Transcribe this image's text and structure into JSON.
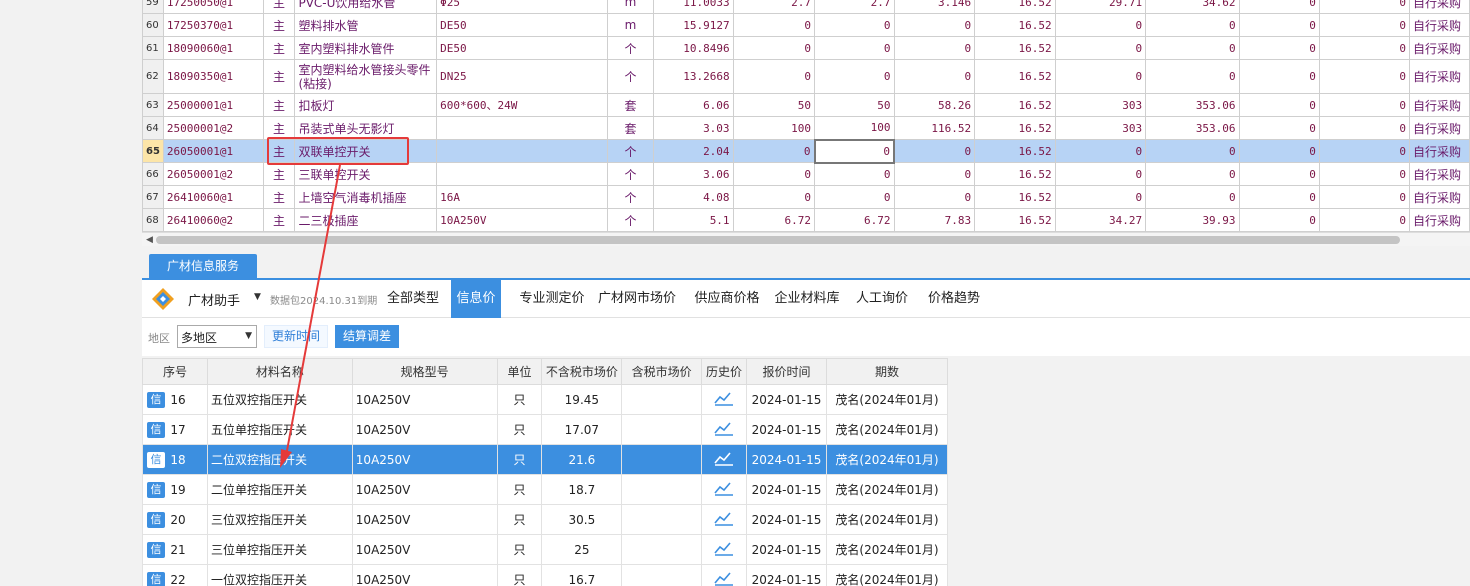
{
  "top_grid": {
    "rows": [
      {
        "num": "59",
        "code": "17250050@1",
        "type": "主",
        "name": "PVC-U饮用给水管",
        "spec": "Φ25",
        "unit": "m",
        "qty": "11.0033",
        "p1": "2.7",
        "p2": "2.7",
        "p3": "3.146",
        "tax": "16.52",
        "a1": "29.71",
        "a2": "34.62",
        "z1": "0",
        "z2": "0",
        "src": "自行采购"
      },
      {
        "num": "60",
        "code": "17250370@1",
        "type": "主",
        "name": "塑料排水管",
        "spec": "DE50",
        "unit": "m",
        "qty": "15.9127",
        "p1": "0",
        "p2": "0",
        "p3": "0",
        "tax": "16.52",
        "a1": "0",
        "a2": "0",
        "z1": "0",
        "z2": "0",
        "src": "自行采购"
      },
      {
        "num": "61",
        "code": "18090060@1",
        "type": "主",
        "name": "室内塑料排水管件",
        "spec": "DE50",
        "unit": "个",
        "qty": "10.8496",
        "p1": "0",
        "p2": "0",
        "p3": "0",
        "tax": "16.52",
        "a1": "0",
        "a2": "0",
        "z1": "0",
        "z2": "0",
        "src": "自行采购"
      },
      {
        "num": "62",
        "code": "18090350@1",
        "type": "主",
        "name": "室内塑料给水管接头零件(粘接)",
        "spec": "DN25",
        "unit": "个",
        "qty": "13.2668",
        "p1": "0",
        "p2": "0",
        "p3": "0",
        "tax": "16.52",
        "a1": "0",
        "a2": "0",
        "z1": "0",
        "z2": "0",
        "src": "自行采购"
      },
      {
        "num": "63",
        "code": "25000001@1",
        "type": "主",
        "name": "扣板灯",
        "spec": "600*600、24W",
        "unit": "套",
        "qty": "6.06",
        "p1": "50",
        "p2": "50",
        "p3": "58.26",
        "tax": "16.52",
        "a1": "303",
        "a2": "353.06",
        "z1": "0",
        "z2": "0",
        "src": "自行采购"
      },
      {
        "num": "64",
        "code": "25000001@2",
        "type": "主",
        "name": "吊装式单头无影灯",
        "spec": "",
        "unit": "套",
        "qty": "3.03",
        "p1": "100",
        "p2": "100",
        "p3": "116.52",
        "tax": "16.52",
        "a1": "303",
        "a2": "353.06",
        "z1": "0",
        "z2": "0",
        "src": "自行采购"
      },
      {
        "num": "65",
        "code": "26050001@1",
        "type": "主",
        "name": "双联单控开关",
        "spec": "",
        "unit": "个",
        "qty": "2.04",
        "p1": "0",
        "p2": "0",
        "p3": "0",
        "tax": "16.52",
        "a1": "0",
        "a2": "0",
        "z1": "0",
        "z2": "0",
        "src": "自行采购"
      },
      {
        "num": "66",
        "code": "26050001@2",
        "type": "主",
        "name": "三联单控开关",
        "spec": "",
        "unit": "个",
        "qty": "3.06",
        "p1": "0",
        "p2": "0",
        "p3": "0",
        "tax": "16.52",
        "a1": "0",
        "a2": "0",
        "z1": "0",
        "z2": "0",
        "src": "自行采购"
      },
      {
        "num": "67",
        "code": "26410060@1",
        "type": "主",
        "name": "上墙空气消毒机插座",
        "spec": "16A",
        "unit": "个",
        "qty": "4.08",
        "p1": "0",
        "p2": "0",
        "p3": "0",
        "tax": "16.52",
        "a1": "0",
        "a2": "0",
        "z1": "0",
        "z2": "0",
        "src": "自行采购"
      },
      {
        "num": "68",
        "code": "26410060@2",
        "type": "主",
        "name": "二三极插座",
        "spec": "10A250V",
        "unit": "个",
        "qty": "5.1",
        "p1": "6.72",
        "p2": "6.72",
        "p3": "7.83",
        "tax": "16.52",
        "a1": "34.27",
        "a2": "39.93",
        "z1": "0",
        "z2": "0",
        "src": "自行采购"
      }
    ]
  },
  "panel": {
    "service_tab": "广材信息服务",
    "app_title": "广材助手",
    "package_info": "数据包2024.10.31到期",
    "nav_tabs": [
      "全部类型",
      "信息价",
      "专业测定价",
      "广材网市场价",
      "供应商价格",
      "企业材料库",
      "人工询价",
      "价格趋势"
    ],
    "active_tab": "信息价",
    "region_label": "地区",
    "region_value": "多地区",
    "btn_refresh": "更新时间",
    "btn_calc": "结算调差"
  },
  "bottom_grid": {
    "headers": [
      "序号",
      "材料名称",
      "规格型号",
      "单位",
      "不含税市场价",
      "含税市场价",
      "历史价",
      "报价时间",
      "期数"
    ],
    "badge": "信",
    "rows": [
      {
        "seq": "16",
        "name": "五位双控指压开关",
        "spec": "10A250V",
        "unit": "只",
        "price": "19.45",
        "tax_price": "",
        "date": "2024-01-15",
        "period": "茂名(2024年01月)"
      },
      {
        "seq": "17",
        "name": "五位单控指压开关",
        "spec": "10A250V",
        "unit": "只",
        "price": "17.07",
        "tax_price": "",
        "date": "2024-01-15",
        "period": "茂名(2024年01月)"
      },
      {
        "seq": "18",
        "name": "二位双控指压开关",
        "spec": "10A250V",
        "unit": "只",
        "price": "21.6",
        "tax_price": "",
        "date": "2024-01-15",
        "period": "茂名(2024年01月)"
      },
      {
        "seq": "19",
        "name": "二位单控指压开关",
        "spec": "10A250V",
        "unit": "只",
        "price": "18.7",
        "tax_price": "",
        "date": "2024-01-15",
        "period": "茂名(2024年01月)"
      },
      {
        "seq": "20",
        "name": "三位双控指压开关",
        "spec": "10A250V",
        "unit": "只",
        "price": "30.5",
        "tax_price": "",
        "date": "2024-01-15",
        "period": "茂名(2024年01月)"
      },
      {
        "seq": "21",
        "name": "三位单控指压开关",
        "spec": "10A250V",
        "unit": "只",
        "price": "25",
        "tax_price": "",
        "date": "2024-01-15",
        "period": "茂名(2024年01月)"
      },
      {
        "seq": "22",
        "name": "一位双控指压开关",
        "spec": "10A250V",
        "unit": "只",
        "price": "16.7",
        "tax_price": "",
        "date": "2024-01-15",
        "period": "茂名(2024年01月)"
      }
    ]
  },
  "colors": {
    "accent": "#3c8fe0",
    "selected_row": "#b7d3f5",
    "annotation": "#e53a3a",
    "text_purple": "#6a1b6a"
  },
  "icons": {
    "logo": "guangcai-logo-icon",
    "history": "line-chart-icon",
    "arrow": "red-annotation-arrow"
  }
}
